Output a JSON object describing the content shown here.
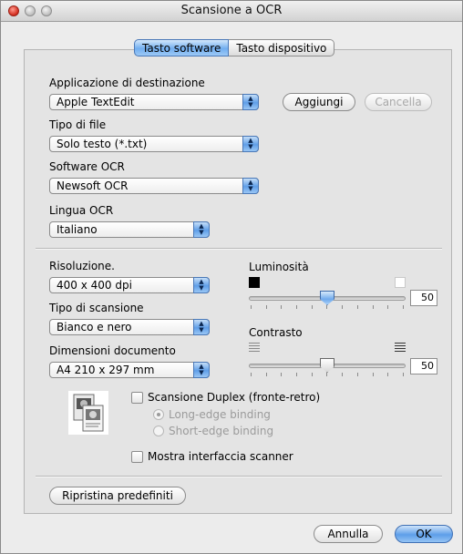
{
  "window": {
    "title": "Scansione a OCR"
  },
  "tabs": {
    "software": "Tasto software",
    "device": "Tasto dispositivo"
  },
  "destination": {
    "label": "Applicazione di destinazione",
    "value": "Apple TextEdit",
    "add_button": "Aggiungi",
    "delete_button": "Cancella"
  },
  "file_type": {
    "label": "Tipo di file",
    "value": "Solo testo (*.txt)"
  },
  "ocr_software": {
    "label": "Software OCR",
    "value": "Newsoft OCR"
  },
  "ocr_language": {
    "label": "Lingua OCR",
    "value": "Italiano"
  },
  "resolution": {
    "label": "Risoluzione.",
    "value": "400 x 400 dpi"
  },
  "scan_type": {
    "label": "Tipo di scansione",
    "value": "Bianco e nero"
  },
  "document_size": {
    "label": "Dimensioni documento",
    "value": "A4  210 x 297 mm"
  },
  "brightness": {
    "label": "Luminosità",
    "value": "50",
    "level": 0.5
  },
  "contrast": {
    "label": "Contrasto",
    "value": "50",
    "level": 0.5
  },
  "duplex": {
    "label": "Scansione Duplex (fronte-retro)",
    "checked": false,
    "long_edge": "Long-edge binding",
    "short_edge": "Short-edge binding"
  },
  "show_scanner_interface": {
    "label": "Mostra interfaccia scanner",
    "checked": false
  },
  "restore_defaults_button": "Ripristina predefiniti",
  "cancel_button": "Annulla",
  "ok_button": "OK",
  "colors": {
    "accent": "#5d9ee9",
    "window_bg": "#ececec",
    "panel_bg": "#e4e4e4"
  },
  "icons": [
    "close-button",
    "minimize-button",
    "zoom-button",
    "popup-arrows-icon",
    "brightness-dark-icon",
    "brightness-light-icon",
    "contrast-low-icon",
    "contrast-high-icon",
    "duplex-scan-image"
  ]
}
